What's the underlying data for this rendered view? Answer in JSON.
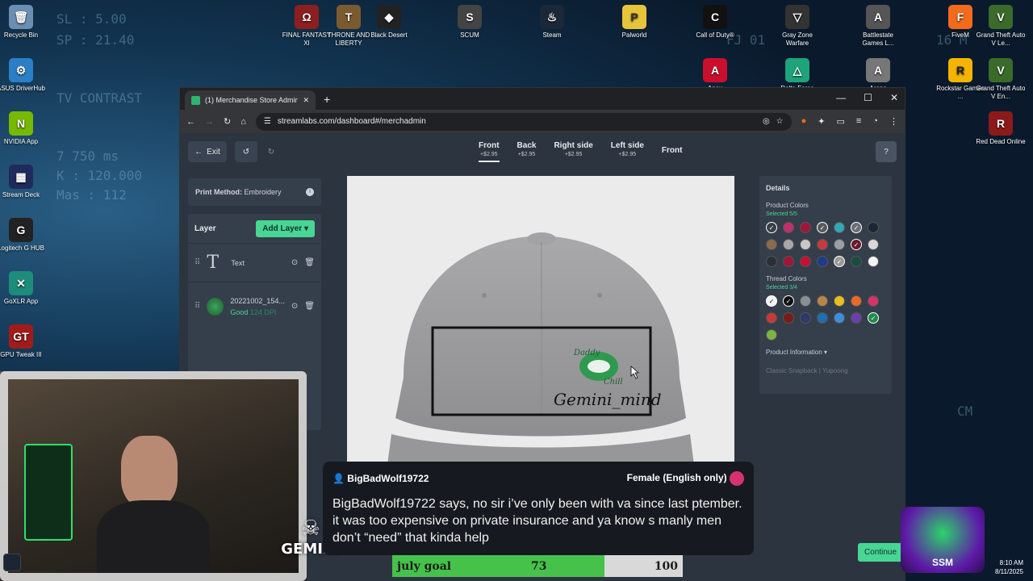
{
  "desktop": {
    "deco": [
      "SL : 5.00",
      "SP : 21.40",
      "TV CONTRAST",
      "7 750 ms",
      "K : 120.000",
      "Mas : 112",
      "FJ 01",
      "16 M",
      "CM"
    ],
    "icons": [
      {
        "label": "Recycle Bin",
        "glyph": "🗑",
        "color": "#6b8fb3"
      },
      {
        "label": "ASUS DriverHub",
        "glyph": "⚙",
        "color": "#2a7fc7"
      },
      {
        "label": "NVIDIA App",
        "glyph": "N",
        "color": "#76b900"
      },
      {
        "label": "Stream Deck",
        "glyph": "▦",
        "color": "#1f2b5c"
      },
      {
        "label": "Logitech G HUB",
        "glyph": "G",
        "color": "#222"
      },
      {
        "label": "GoXLR App",
        "glyph": "✕",
        "color": "#1e8c7a"
      },
      {
        "label": "GPU Tweak III",
        "glyph": "GT",
        "color": "#a21b1b"
      },
      {
        "label": "FINAL FANTASY XI",
        "glyph": "Ω",
        "color": "#8c1f1f"
      },
      {
        "label": "THRONE AND LIBERTY",
        "glyph": "T",
        "color": "#7a5b2f"
      },
      {
        "label": "Black Desert",
        "glyph": "◆",
        "color": "#222"
      },
      {
        "label": "SCUM",
        "glyph": "S",
        "color": "#444"
      },
      {
        "label": "Steam",
        "glyph": "♨",
        "color": "#1b2838"
      },
      {
        "label": "Palworld",
        "glyph": "P",
        "color": "#e8c43a"
      },
      {
        "label": "Call of Duty®",
        "glyph": "C",
        "color": "#111"
      },
      {
        "label": "Gray Zone Warfare",
        "glyph": "▽",
        "color": "#333"
      },
      {
        "label": "Battlestate Games L...",
        "glyph": "A",
        "color": "#555"
      },
      {
        "label": "FiveM",
        "glyph": "F",
        "color": "#f26b1d"
      },
      {
        "label": "Grand Theft Auto V Le...",
        "glyph": "V",
        "color": "#3a6b2b"
      },
      {
        "label": "Rockstar Games ...",
        "glyph": "R",
        "color": "#f5b400"
      },
      {
        "label": "Grand Theft Auto V En...",
        "glyph": "V",
        "color": "#3a6b2b"
      },
      {
        "label": "Red Dead Online",
        "glyph": "R",
        "color": "#8c1a1a"
      },
      {
        "label": "Apex",
        "glyph": "A",
        "color": "#c8102e"
      },
      {
        "label": "Delta Force",
        "glyph": "△",
        "color": "#1ea37a"
      },
      {
        "label": "Arena",
        "glyph": "A",
        "color": "#777"
      }
    ]
  },
  "browser": {
    "tab_title": "(1) Merchandise Store Admin /",
    "url": "streamlabs.com/dashboard#/merchadmin",
    "new_tab": "+",
    "window_controls": [
      "—",
      "☐",
      "✕"
    ]
  },
  "app": {
    "exit_label": "Exit",
    "views": [
      {
        "label": "Front",
        "price": "+$2.95",
        "active": true
      },
      {
        "label": "Back",
        "price": "+$2.95"
      },
      {
        "label": "Right side",
        "price": "+$2.95"
      },
      {
        "label": "Left side",
        "price": "+$2.95"
      },
      {
        "label": "Front",
        "price": ""
      }
    ],
    "print_method_label": "Print Method:",
    "print_method_value": "Embroidery",
    "layer_heading": "Layer",
    "add_layer_label": "Add Layer",
    "layers": [
      {
        "name": "Text",
        "status": "",
        "dpi": ""
      },
      {
        "name": "20221002_154...",
        "status": "Good",
        "dpi": "124 DPI"
      }
    ],
    "canvas_text": "Gemini_mind",
    "logo_text_top": "Daddy",
    "logo_text_bottom": "Chill",
    "details": {
      "title": "Details",
      "product_colors_label": "Product Colors",
      "product_colors_selected": "Selected 5/5",
      "product_colors": [
        "#3a3f48",
        "#c0306a",
        "#a0163a",
        "#5a5a5a",
        "#35a6b5",
        "#6b7078",
        "#1b2636",
        "#8a6b4a",
        "#a8a8a8",
        "#c8c8c8",
        "#c83a3a",
        "#9aa0a6",
        "#6a1a2e",
        "#d8d8d8",
        "#2b2f38",
        "#a0163a",
        "#c8102e",
        "#1e3a8a",
        "#9a9a9a",
        "#1b4d3e",
        "#f2f2f2"
      ],
      "thread_colors_label": "Thread Colors",
      "thread_colors_selected": "Selected 3/4",
      "thread_colors": [
        "#f2f2f2",
        "#111111",
        "#8a8f96",
        "#b8864a",
        "#e6c01e",
        "#e8692a",
        "#d6336c",
        "#c83a3a",
        "#7a1a1a",
        "#2a3a6a",
        "#1e6eb0",
        "#3c8de0",
        "#6a3fb0",
        "#1e8c4a",
        "#7cb342"
      ],
      "product_info_label": "Product Information",
      "product_name": "Classic Snapback | Yupoong"
    },
    "continue_label": "Continue"
  },
  "overlay": {
    "tts_user": "BigBadWolf19722",
    "tts_voice": "Female (English only)",
    "tts_message": "BigBadWolf19722 says, no sir i’ve only been with va since last ptember. it was too expensive on private insurance and ya know s manly men don’t “need” that kinda help",
    "goal_label": "july goal",
    "goal_current": "73",
    "goal_target": "100",
    "goal_fraction": 0.73,
    "logo_name": "GEMINI",
    "ssm_label": "SSM",
    "time": "8:10 AM",
    "date": "8/11/2025"
  }
}
